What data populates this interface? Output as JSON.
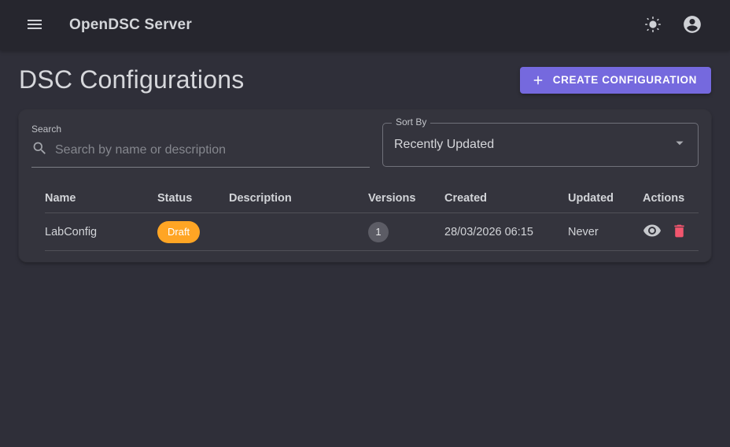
{
  "app_bar": {
    "title": "OpenDSC Server",
    "icons": {
      "menu": "hamburger (three horizontal bars)",
      "theme_toggle": "sun / light-mode",
      "account": "person in circle"
    }
  },
  "page": {
    "title": "DSC Configurations",
    "create_button": {
      "label": "CREATE CONFIGURATION",
      "icon": "plus"
    }
  },
  "filters": {
    "search": {
      "label": "Search",
      "placeholder": "Search by name or description",
      "value": "",
      "icon": "magnifier"
    },
    "sort": {
      "label": "Sort By",
      "value": "Recently Updated",
      "icon": "caret-down"
    }
  },
  "table": {
    "columns": [
      "Name",
      "Status",
      "Description",
      "Versions",
      "Created",
      "Updated",
      "Actions"
    ],
    "rows": [
      {
        "name": "LabConfig",
        "status": "Draft",
        "description": "",
        "versions": "1",
        "created": "28/03/2026 06:15",
        "updated": "Never",
        "actions": [
          "view (eye)",
          "delete (trash)"
        ]
      }
    ]
  },
  "colors": {
    "appbar_bg": "#26262e",
    "page_bg": "#2f2f39",
    "card_bg": "#34343d",
    "accent_purple": "#7569de",
    "status_draft": "#ffa524",
    "delete_red": "#f2566e",
    "versions_chip_bg": "#5c5c65",
    "text_primary": "#d4d6da"
  }
}
